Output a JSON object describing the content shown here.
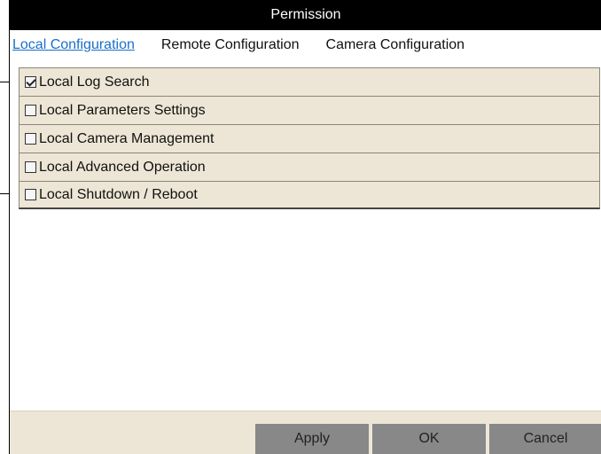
{
  "window": {
    "title": "Permission"
  },
  "tabs": [
    {
      "label": "Local Configuration",
      "active": true
    },
    {
      "label": "Remote Configuration",
      "active": false
    },
    {
      "label": "Camera Configuration",
      "active": false
    }
  ],
  "permissions": [
    {
      "label": "Local Log Search",
      "checked": true
    },
    {
      "label": "Local Parameters Settings",
      "checked": false
    },
    {
      "label": "Local Camera Management",
      "checked": false
    },
    {
      "label": "Local Advanced Operation",
      "checked": false
    },
    {
      "label": "Local Shutdown / Reboot",
      "checked": false
    }
  ],
  "buttons": {
    "apply": "Apply",
    "ok": "OK",
    "cancel": "Cancel"
  },
  "colors": {
    "accent": "#1a6fc9",
    "row_bg": "#ede6d6",
    "button_bg": "#888888",
    "titlebar_bg": "#000000"
  }
}
